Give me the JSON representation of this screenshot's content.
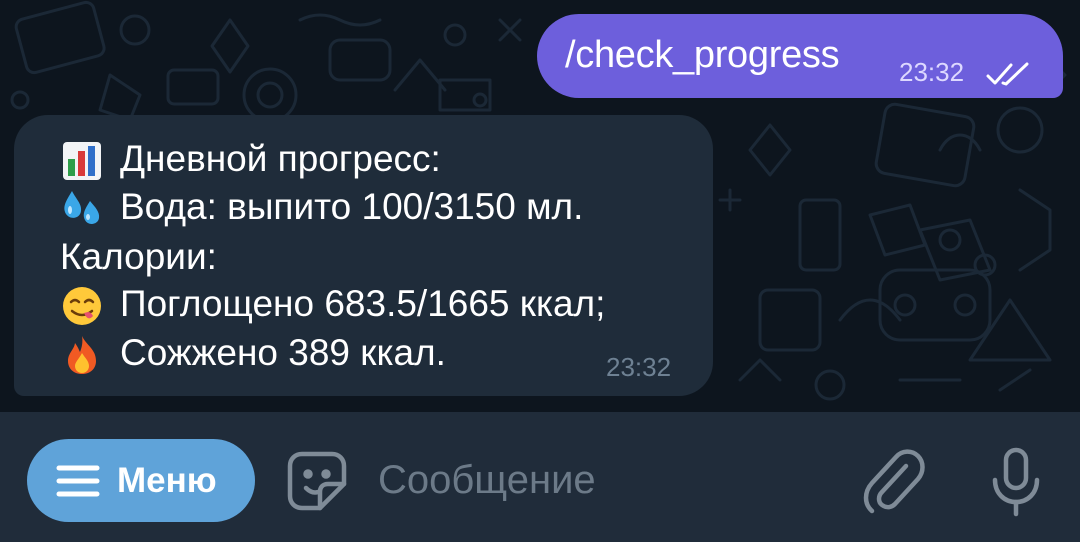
{
  "outgoing_message": {
    "text": "/check_progress",
    "time": "23:32",
    "status_icon": "double-check-icon"
  },
  "incoming_message": {
    "lines": [
      {
        "emoji": "bar-chart-emoji",
        "text": "Дневной прогресс:"
      },
      {
        "emoji": "sweat-droplets-emoji",
        "text": "Вода: выпито 100/3150 мл."
      },
      {
        "emoji": "",
        "text": "Калории:"
      },
      {
        "emoji": "face-savoring-food-emoji",
        "text": "Поглощено 683.5/1665 ккал;"
      },
      {
        "emoji": "fire-emoji",
        "text": "Сожжено 389 ккал."
      }
    ],
    "time": "23:32"
  },
  "input_bar": {
    "menu_label": "Меню",
    "placeholder": "Сообщение",
    "value": "",
    "icons": [
      "menu-icon",
      "sticker-icon",
      "paperclip-icon",
      "microphone-icon"
    ]
  },
  "colors": {
    "chat_background": "#0d151e",
    "outgoing_bubble": "#6d5fdc",
    "incoming_bubble": "#1f2c3a",
    "input_bar": "#202c3a",
    "menu_button": "#5fa3d9",
    "icon_gray": "#7f8b97"
  }
}
